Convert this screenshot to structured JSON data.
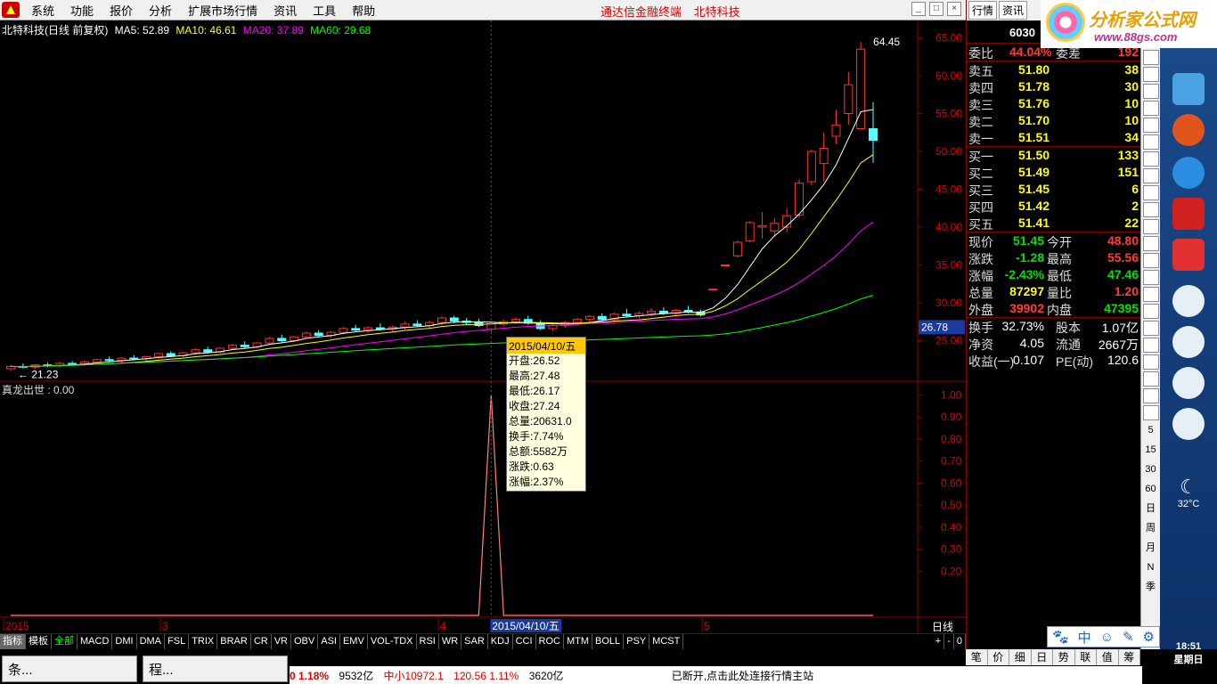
{
  "menu": {
    "items": [
      "系统",
      "功能",
      "报价",
      "分析",
      "扩展市场行情",
      "资讯",
      "工具",
      "帮助"
    ],
    "center_title": "通达信金融终端",
    "center_stock": "北特科技"
  },
  "right_tabs": [
    "行情",
    "资讯"
  ],
  "brand": {
    "name": "分析家公式网",
    "url": "www.88gs.com"
  },
  "stock": {
    "code": "6030",
    "title": "北特科技(日线 前复权)",
    "ma": [
      {
        "label": "MA5: 52.89",
        "color": "#ffffff"
      },
      {
        "label": "MA10: 46.61",
        "color": "#ffff00"
      },
      {
        "label": "MA20: 37.89",
        "color": "#ff00ff"
      },
      {
        "label": "MA60: 29.68",
        "color": "#00ff00"
      }
    ]
  },
  "quote": {
    "weibi": {
      "label": "委比",
      "value": "44.04%",
      "label2": "委差",
      "value2": "192"
    },
    "sell": [
      {
        "label": "卖五",
        "price": "51.80",
        "vol": "38"
      },
      {
        "label": "卖四",
        "price": "51.78",
        "vol": "30"
      },
      {
        "label": "卖三",
        "price": "51.76",
        "vol": "10"
      },
      {
        "label": "卖二",
        "price": "51.70",
        "vol": "10"
      },
      {
        "label": "卖一",
        "price": "51.51",
        "vol": "34"
      }
    ],
    "buy": [
      {
        "label": "买一",
        "price": "51.50",
        "vol": "133"
      },
      {
        "label": "买二",
        "price": "51.49",
        "vol": "151"
      },
      {
        "label": "买三",
        "price": "51.45",
        "vol": "6"
      },
      {
        "label": "买四",
        "price": "51.42",
        "vol": "2"
      },
      {
        "label": "买五",
        "price": "51.41",
        "vol": "22"
      }
    ],
    "stats": [
      {
        "l1": "现价",
        "v1": "51.45",
        "c1": "#00e000",
        "l2": "今开",
        "v2": "48.80",
        "c2": "#ff3c3c"
      },
      {
        "l1": "涨跌",
        "v1": "-1.28",
        "c1": "#00e000",
        "l2": "最高",
        "v2": "55.56",
        "c2": "#ff3c3c"
      },
      {
        "l1": "涨幅",
        "v1": "-2.43%",
        "c1": "#00e000",
        "l2": "最低",
        "v2": "47.46",
        "c2": "#00e000"
      },
      {
        "l1": "总量",
        "v1": "87297",
        "c1": "#ffff00",
        "l2": "量比",
        "v2": "1.20",
        "c2": "#ff3c3c"
      },
      {
        "l1": "外盘",
        "v1": "39902",
        "c1": "#ff3c3c",
        "l2": "内盘",
        "v2": "47395",
        "c2": "#00e000"
      }
    ],
    "stats2": [
      {
        "l1": "换手",
        "v1": "32.73%",
        "l2": "股本",
        "v2": "1.07亿"
      },
      {
        "l1": "净资",
        "v1": "4.05",
        "l2": "流通",
        "v2": "2667万"
      },
      {
        "l1": "收益(一)",
        "v1": "0.107",
        "l2": "PE(动)",
        "v2": "120.6"
      }
    ]
  },
  "chart": {
    "price_axis": [
      "65.00",
      "60.00",
      "55.00",
      "50.00",
      "45.00",
      "40.00",
      "35.00",
      "30.00",
      "25.00"
    ],
    "current_price_label": "26.78",
    "high_label": "64.45",
    "low_label": "21.23",
    "indicator_title": "真龙出世 : 0.00",
    "ind_axis": [
      "1.00",
      "0.90",
      "0.80",
      "0.70",
      "0.60",
      "0.50",
      "0.40",
      "0.30",
      "0.20"
    ],
    "date_labels": [
      "2015",
      "3",
      "4",
      "2015/04/10/五",
      "5"
    ],
    "period": "日线"
  },
  "chart_data": {
    "type": "candlestick",
    "title": "北特科技(日线 前复权)",
    "ylim": [
      20,
      66
    ],
    "candles": [
      [
        21.3,
        21.8,
        21.0,
        21.6
      ],
      [
        21.6,
        22.0,
        21.3,
        21.5
      ],
      [
        21.5,
        21.9,
        21.2,
        21.8
      ],
      [
        21.8,
        22.1,
        21.5,
        21.7
      ],
      [
        21.7,
        22.2,
        21.5,
        22.0
      ],
      [
        22.0,
        22.3,
        21.7,
        21.9
      ],
      [
        21.9,
        22.4,
        21.7,
        22.2
      ],
      [
        22.2,
        22.6,
        22.0,
        22.5
      ],
      [
        22.5,
        22.9,
        22.2,
        22.4
      ],
      [
        22.4,
        22.8,
        22.1,
        22.7
      ],
      [
        22.7,
        23.1,
        22.4,
        22.6
      ],
      [
        22.6,
        23.0,
        22.3,
        22.9
      ],
      [
        22.9,
        23.4,
        22.6,
        23.3
      ],
      [
        23.3,
        23.6,
        22.9,
        23.0
      ],
      [
        23.0,
        23.5,
        22.8,
        23.4
      ],
      [
        23.4,
        24.0,
        23.2,
        23.8
      ],
      [
        23.8,
        24.2,
        23.3,
        23.5
      ],
      [
        23.5,
        24.1,
        23.3,
        24.0
      ],
      [
        24.0,
        24.6,
        23.8,
        24.4
      ],
      [
        24.4,
        24.9,
        24.0,
        24.2
      ],
      [
        24.2,
        24.8,
        24.0,
        24.7
      ],
      [
        24.7,
        25.5,
        24.4,
        25.3
      ],
      [
        25.3,
        25.8,
        24.8,
        25.0
      ],
      [
        25.0,
        25.6,
        24.8,
        25.5
      ],
      [
        25.5,
        26.2,
        25.3,
        26.0
      ],
      [
        26.0,
        26.4,
        25.5,
        25.7
      ],
      [
        25.7,
        26.3,
        25.4,
        26.1
      ],
      [
        26.1,
        26.8,
        25.9,
        26.6
      ],
      [
        26.6,
        27.1,
        26.2,
        26.4
      ],
      [
        26.4,
        26.9,
        26.0,
        26.7
      ],
      [
        26.7,
        27.3,
        26.3,
        26.5
      ],
      [
        26.5,
        27.0,
        26.1,
        26.8
      ],
      [
        26.8,
        27.5,
        26.5,
        27.2
      ],
      [
        27.2,
        27.7,
        26.8,
        27.0
      ],
      [
        27.0,
        27.6,
        26.7,
        27.4
      ],
      [
        27.4,
        28.2,
        27.1,
        28.0
      ],
      [
        28.0,
        28.3,
        27.3,
        27.6
      ],
      [
        27.6,
        28.0,
        27.1,
        27.4
      ],
      [
        27.4,
        27.9,
        26.8,
        27.0
      ],
      [
        26.52,
        27.48,
        26.17,
        27.24
      ],
      [
        27.2,
        27.8,
        26.9,
        27.5
      ],
      [
        27.5,
        28.1,
        27.2,
        27.8
      ],
      [
        27.8,
        28.3,
        27.1,
        27.3
      ],
      [
        27.3,
        27.7,
        26.4,
        26.6
      ],
      [
        26.6,
        27.2,
        26.3,
        27.0
      ],
      [
        27.0,
        27.6,
        26.7,
        27.4
      ],
      [
        27.4,
        28.0,
        27.0,
        27.8
      ],
      [
        27.8,
        28.4,
        27.4,
        28.2
      ],
      [
        28.2,
        28.6,
        27.6,
        27.8
      ],
      [
        27.8,
        28.7,
        27.5,
        28.5
      ],
      [
        28.5,
        29.2,
        28.1,
        28.3
      ],
      [
        28.3,
        28.9,
        27.9,
        28.6
      ],
      [
        28.6,
        29.3,
        28.2,
        28.9
      ],
      [
        28.9,
        29.4,
        28.4,
        28.6
      ],
      [
        28.6,
        29.2,
        28.3,
        29.0
      ],
      [
        29.0,
        29.6,
        28.6,
        28.8
      ],
      [
        28.8,
        29.1,
        28.2,
        28.4
      ],
      [
        31.8,
        31.8,
        31.8,
        31.8
      ],
      [
        35.0,
        35.0,
        35.0,
        35.0
      ],
      [
        36.2,
        38.2,
        36.0,
        38.0
      ],
      [
        38.2,
        40.8,
        38.0,
        40.6
      ],
      [
        40.0,
        42.0,
        38.5,
        40.2
      ],
      [
        39.5,
        41.2,
        38.7,
        40.5
      ],
      [
        40.0,
        42.5,
        39.3,
        41.5
      ],
      [
        41.6,
        46.3,
        41.2,
        45.8
      ],
      [
        46.0,
        50.2,
        45.5,
        50.0
      ],
      [
        48.4,
        52.5,
        46.0,
        50.4
      ],
      [
        52.0,
        55.5,
        51.0,
        53.5
      ],
      [
        55.0,
        60.5,
        53.5,
        58.8
      ],
      [
        53.0,
        64.45,
        53.0,
        63.5
      ],
      [
        53.0,
        56.5,
        48.5,
        51.45
      ]
    ],
    "ma": [
      {
        "name": "MA5",
        "color": "#ffffff"
      },
      {
        "name": "MA10",
        "color": "#ffff00"
      },
      {
        "name": "MA20",
        "color": "#ff00ff"
      },
      {
        "name": "MA60",
        "color": "#00ff00"
      }
    ],
    "tooltip": {
      "date": "2015/04/10/五",
      "rows": [
        "开盘:26.52",
        "最高:27.48",
        "最低:26.17",
        "收盘:27.24",
        "总量:20631.0",
        "换手:7.74%",
        "总额:5582万",
        "涨跌:0.63",
        "涨幅:2.37%"
      ]
    },
    "indicator": {
      "name": "真龙出世",
      "spike_index": 39,
      "value": 1.0,
      "ylim": [
        0,
        1.05
      ]
    }
  },
  "ind_tabs": [
    "指标",
    "模板",
    "全部",
    "MACD",
    "DMI",
    "DMA",
    "FSL",
    "TRIX",
    "BRAR",
    "CR",
    "VR",
    "OBV",
    "ASI",
    "EMV",
    "VOL-TDX",
    "RSI",
    "WR",
    "SAR",
    "KDJ",
    "CCI",
    "ROC",
    "MTM",
    "BOLL",
    "PSY",
    "MCST"
  ],
  "ind_controls": [
    "+",
    "-",
    "0"
  ],
  "taskbar": {
    "tasks": [
      "条...",
      "程..."
    ],
    "status": [
      "0 1.18%",
      "9532亿",
      "中小10972.1",
      "120.56 1.11%",
      "3620亿",
      "已断开,点击此处连接行情主站"
    ],
    "right_tabs": [
      "笔",
      "价",
      "细",
      "日",
      "势",
      "联",
      "值",
      "筹"
    ],
    "weather": "32°C",
    "time": "18:51",
    "weekday": "星期日"
  },
  "vtool": [
    "5",
    "15",
    "30",
    "60",
    "日",
    "周",
    "月",
    "N",
    "季"
  ],
  "ime": [
    "中",
    "☺",
    "✎",
    "⚙"
  ]
}
